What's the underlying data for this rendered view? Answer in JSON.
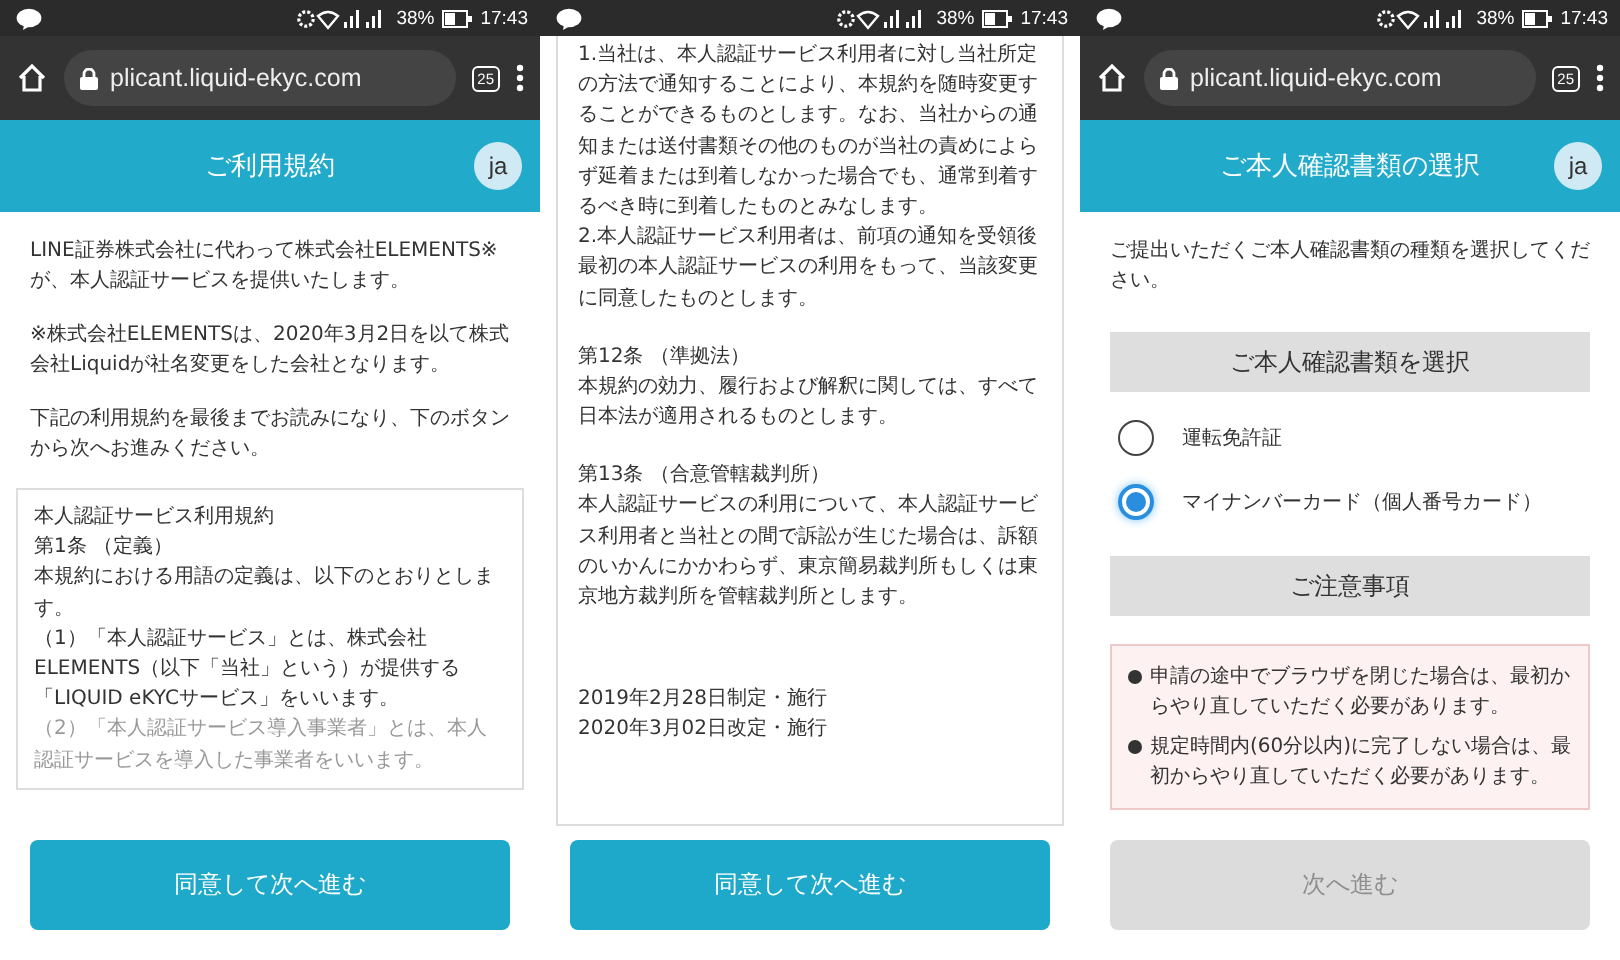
{
  "phones": [
    {
      "kind": "intro",
      "status_bar": {
        "battery": "38%",
        "time": "17:43"
      },
      "browser": {
        "url": "plicant.liquid-ekyc.com",
        "tab_count": "25"
      },
      "header": {
        "title": "ご利用規約",
        "avatar": "ja"
      },
      "paragraphs": [
        "LINE証券株式会社に代わって株式会社ELEMENTS※が、本人認証サービスを提供いたします。",
        "※株式会社ELEMENTSは、2020年3月2日を以て株式会社Liquidが社名変更をした会社となります。",
        "下記の利用規約を最後までお読みになり、下のボタンから次へお進みください。"
      ],
      "terms": [
        "本人認証サービス利用規約",
        "第1条 （定義）",
        "本規約における用語の定義は、以下のとおりとします。",
        "（1）「本人認証サービス」とは、株式会社ELEMENTS（以下「当社」という）が提供する「LIQUID eKYCサービス」をいいます。",
        "（2）「本人認証サービス導入事業者」とは、本人認証サービスを導入した事業者をいいます。"
      ],
      "button": {
        "label": "同意して次へ進む",
        "disabled": false
      }
    },
    {
      "kind": "scrolled",
      "status_bar": {
        "battery": "38%",
        "time": "17:43"
      },
      "terms": [
        "1.当社は、本人認証サービス利用者に対し当社所定の方法で通知することにより、本規約を随時変更することができるものとします。なお、当社からの通知または送付書類その他のものが当社の責めによらず延着または到着しなかった場合でも、通常到着するべき時に到着したものとみなします。",
        "2.本人認証サービス利用者は、前項の通知を受領後最初の本人認証サービスの利用をもって、当該変更に同意したものとします。",
        "第12条 （準拠法）",
        "本規約の効力、履行および解釈に関しては、すべて日本法が適用されるものとします。",
        "第13条 （合意管轄裁判所）",
        "本人認証サービスの利用について、本人認証サービス利用者と当社との間で訴訟が生じた場合は、訴額のいかんにかかわらず、東京簡易裁判所もしくは東京地方裁判所を管轄裁判所とします。",
        "2019年2月28日制定・施行",
        "2020年3月02日改定・施行"
      ],
      "button": {
        "label": "同意して次へ進む",
        "disabled": false
      }
    },
    {
      "kind": "select",
      "status_bar": {
        "battery": "38%",
        "time": "17:43"
      },
      "browser": {
        "url": "plicant.liquid-ekyc.com",
        "tab_count": "25"
      },
      "header": {
        "title": "ご本人確認書類の選択",
        "avatar": "ja"
      },
      "paragraphs": [
        "ご提出いただくご本人確認書類の種類を選択してください。"
      ],
      "section_title": "ご本人確認書類を選択",
      "options": [
        {
          "label": "運転免許証",
          "selected": false
        },
        {
          "label": "マイナンバーカード（個人番号カード）",
          "selected": true
        }
      ],
      "notes_title": "ご注意事項",
      "notes": [
        "申請の途中でブラウザを閉じた場合は、最初からやり直していただく必要があります。",
        "規定時間内(60分以内)に完了しない場合は、最初からやり直していただく必要があります。"
      ],
      "button": {
        "label": "次へ進む",
        "disabled": true
      }
    }
  ]
}
